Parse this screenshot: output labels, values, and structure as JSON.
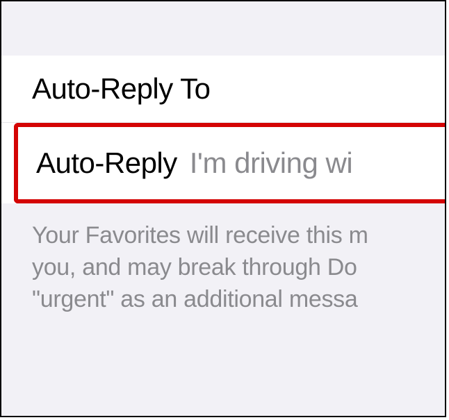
{
  "rows": {
    "autoReplyTo": {
      "label": "Auto-Reply To"
    },
    "autoReply": {
      "label": "Auto-Reply",
      "value": "I'm driving wi"
    }
  },
  "footer": {
    "line1": "Your Favorites will receive this m",
    "line2": "you, and may break through Do ",
    "line3": "\"urgent\" as an additional messa"
  }
}
